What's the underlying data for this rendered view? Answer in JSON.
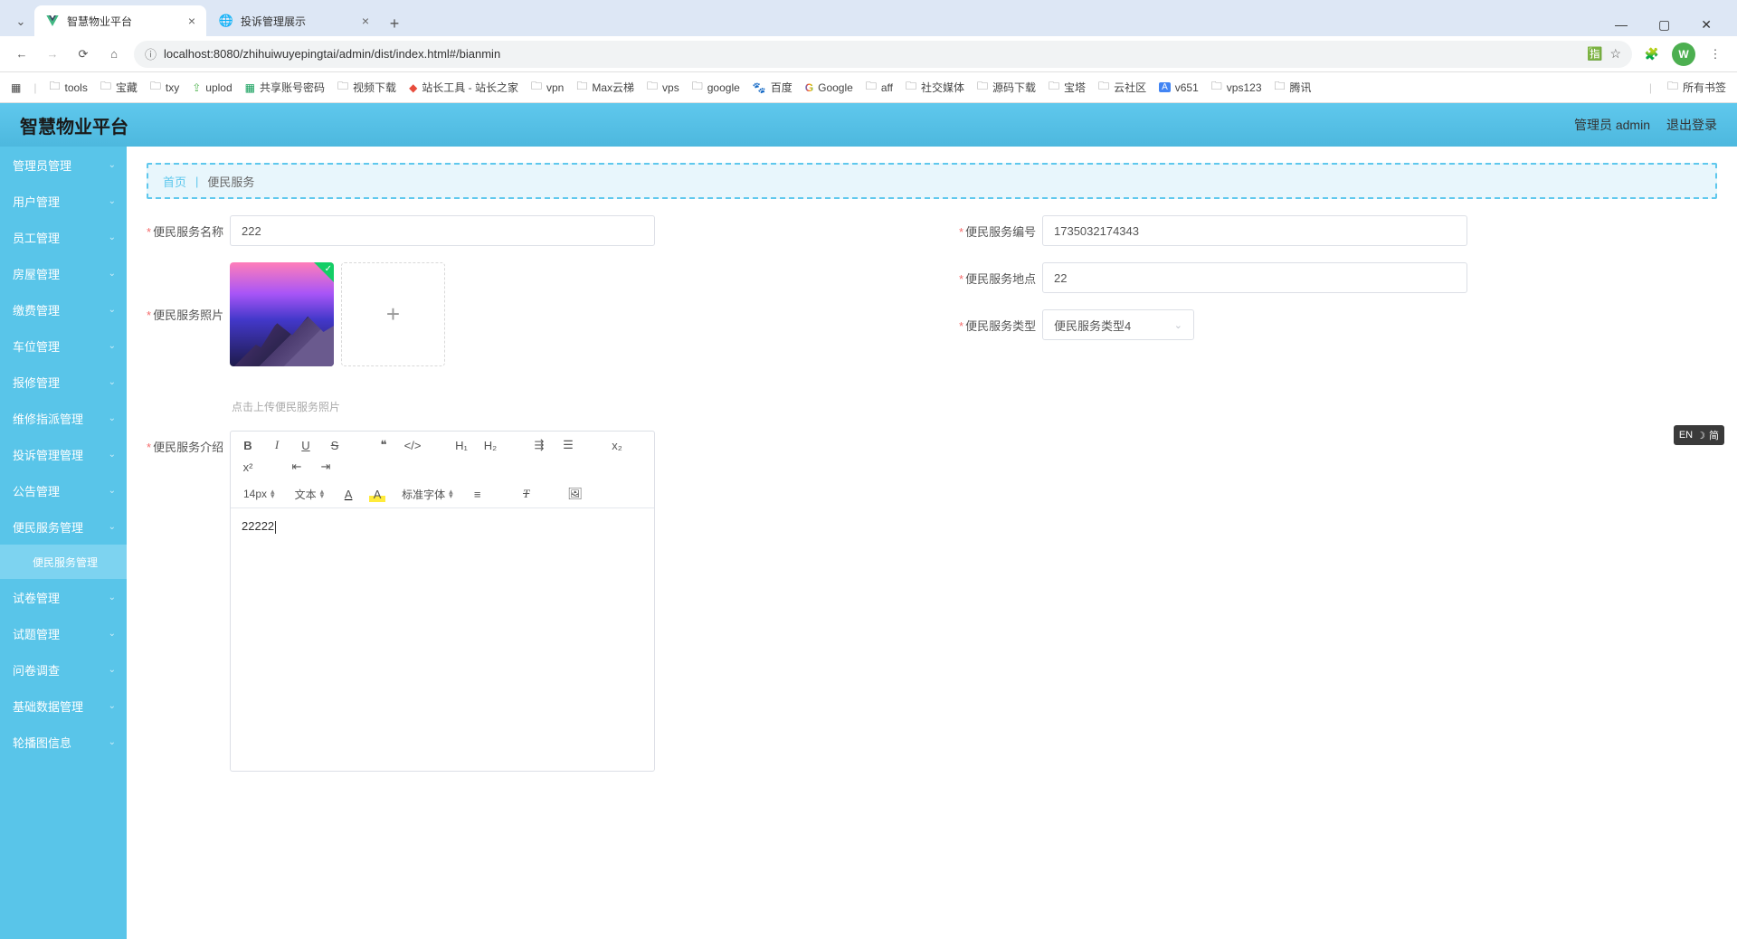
{
  "browser": {
    "tabs": [
      {
        "title": "智慧物业平台",
        "active": true
      },
      {
        "title": "投诉管理展示",
        "active": false
      }
    ],
    "url": "localhost:8080/zhihuiwuyepingtai/admin/dist/index.html#/bianmin",
    "avatar_letter": "W"
  },
  "bookmarks": {
    "items": [
      "tools",
      "宝藏",
      "txy",
      "uplod",
      "共享账号密码",
      "视频下载",
      "站长工具 - 站长之家",
      "vpn",
      "Max云梯",
      "vps",
      "google",
      "百度",
      "Google",
      "aff",
      "社交媒体",
      "源码下载",
      "宝塔",
      "云社区",
      "v651",
      "vps123",
      "腾讯"
    ],
    "all": "所有书签"
  },
  "header": {
    "title": "智慧物业平台",
    "user_label": "管理员 admin",
    "logout": "退出登录"
  },
  "sidebar": {
    "items": [
      "管理员管理",
      "用户管理",
      "员工管理",
      "房屋管理",
      "缴费管理",
      "车位管理",
      "报修管理",
      "维修指派管理",
      "投诉管理管理",
      "公告管理",
      "便民服务管理",
      "试卷管理",
      "试题管理",
      "问卷调查",
      "基础数据管理",
      "轮播图信息"
    ],
    "active_sub": "便民服务管理"
  },
  "breadcrumb": {
    "home": "首页",
    "current": "便民服务"
  },
  "form": {
    "name_label": "便民服务名称",
    "name_value": "222",
    "code_label": "便民服务编号",
    "code_value": "1735032174343",
    "photo_label": "便民服务照片",
    "photo_hint": "点击上传便民服务照片",
    "location_label": "便民服务地点",
    "location_value": "22",
    "type_label": "便民服务类型",
    "type_value": "便民服务类型4",
    "intro_label": "便民服务介绍",
    "intro_value": "22222"
  },
  "editor": {
    "font_size": "14px",
    "text_style": "文本",
    "font_family": "标准字体"
  },
  "ime": {
    "lang": "EN",
    "mode": "简"
  }
}
